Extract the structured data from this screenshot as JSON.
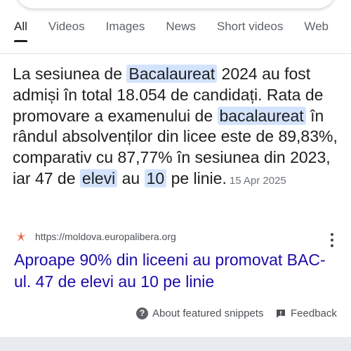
{
  "tabs": [
    {
      "label": "All",
      "active": true
    },
    {
      "label": "Videos"
    },
    {
      "label": "Images"
    },
    {
      "label": "News"
    },
    {
      "label": "Short videos"
    },
    {
      "label": "Web"
    }
  ],
  "snippet": {
    "t1": "La sesiunea de ",
    "h1": "Bacalaureat",
    "t2": " 2024 au fost admiși în total 18.054 de candidați. Rata de promovare a examenului de ",
    "h2": "bacalaureat",
    "t3": " în rândul absolvenților din licee este de 89,83%, comparativ cu 87,77% în sesiunea din 2023, iar 47 de ",
    "h3": "elevi",
    "t4": " au ",
    "h4": "10",
    "t5": " pe linie.",
    "date": "15 Apr 2025"
  },
  "source": {
    "url": "https://moldova.europalibera.org",
    "favicon_color": "#e8542f"
  },
  "result": {
    "title": "Aproape 90% din liceeni au promovat BAC-ul. 47 de elevi au 10 pe linie",
    "color": "#1a0dab"
  },
  "footer": {
    "about_label": "About featured snippets",
    "feedback_label": "Feedback"
  },
  "colors": {
    "highlight": "#d3e3fd"
  }
}
